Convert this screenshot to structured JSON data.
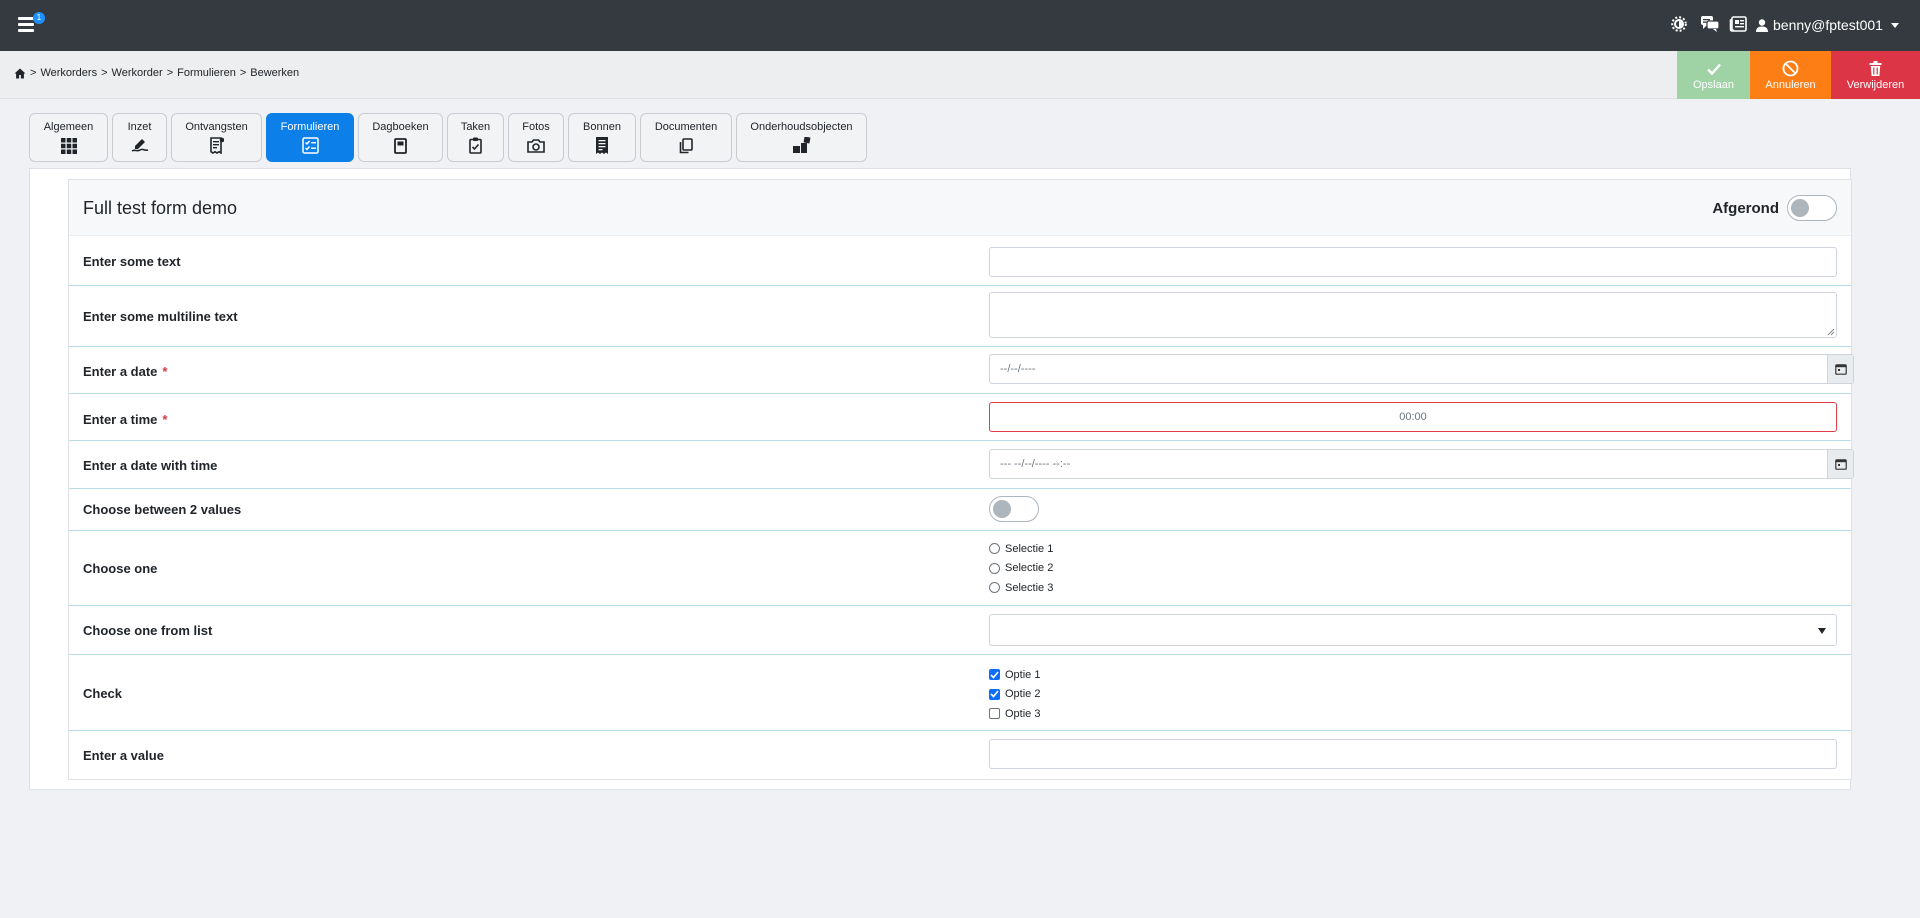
{
  "navbar": {
    "menu_badge": "1",
    "icons": [
      "theme-icon",
      "chat-icon",
      "news-icon"
    ],
    "user_label": "benny@fptest001"
  },
  "breadcrumb": {
    "items": [
      "Werkorders",
      "Werkorder",
      "Formulieren",
      "Bewerken"
    ]
  },
  "actions": {
    "save": "Opslaan",
    "cancel": "Annuleren",
    "delete": "Verwijderen",
    "colors": {
      "save": "#9fd3a6",
      "cancel": "#fd7e14",
      "delete": "#dc3545"
    }
  },
  "tabs": [
    {
      "label": "Algemeen",
      "icon": "grid-icon"
    },
    {
      "label": "Inzet",
      "icon": "signature-icon"
    },
    {
      "label": "Ontvangsten",
      "icon": "receipt-icon"
    },
    {
      "label": "Formulieren",
      "icon": "checklist-icon",
      "active": true
    },
    {
      "label": "Dagboeken",
      "icon": "journal-icon"
    },
    {
      "label": "Taken",
      "icon": "clipboard-icon"
    },
    {
      "label": "Fotos",
      "icon": "camera-icon"
    },
    {
      "label": "Bonnen",
      "icon": "receipt-list-icon"
    },
    {
      "label": "Documenten",
      "icon": "documents-icon"
    },
    {
      "label": "Onderhoudsobjecten",
      "icon": "boxes-icon"
    }
  ],
  "form": {
    "title": "Full test form demo",
    "completed_label": "Afgerond",
    "fields": {
      "text": {
        "label": "Enter some text",
        "value": ""
      },
      "multiline": {
        "label": "Enter some multiline text",
        "value": ""
      },
      "date": {
        "label": "Enter a date",
        "required": "*",
        "placeholder": "--/--/----"
      },
      "time": {
        "label": "Enter a time",
        "required": "*",
        "placeholder": "00:00"
      },
      "datetime": {
        "label": "Enter a date with time",
        "placeholder": "--- --/--/---- --:--"
      },
      "toggle": {
        "label": "Choose between 2 values"
      },
      "radio": {
        "label": "Choose one",
        "options": [
          "Selectie 1",
          "Selectie 2",
          "Selectie 3"
        ]
      },
      "select": {
        "label": "Choose one from list",
        "value": ""
      },
      "check": {
        "label": "Check",
        "options": [
          "Optie 1",
          "Optie 2",
          "Optie 3"
        ],
        "checked": [
          true,
          true,
          false
        ]
      },
      "value": {
        "label": "Enter a value",
        "value": ""
      }
    }
  }
}
